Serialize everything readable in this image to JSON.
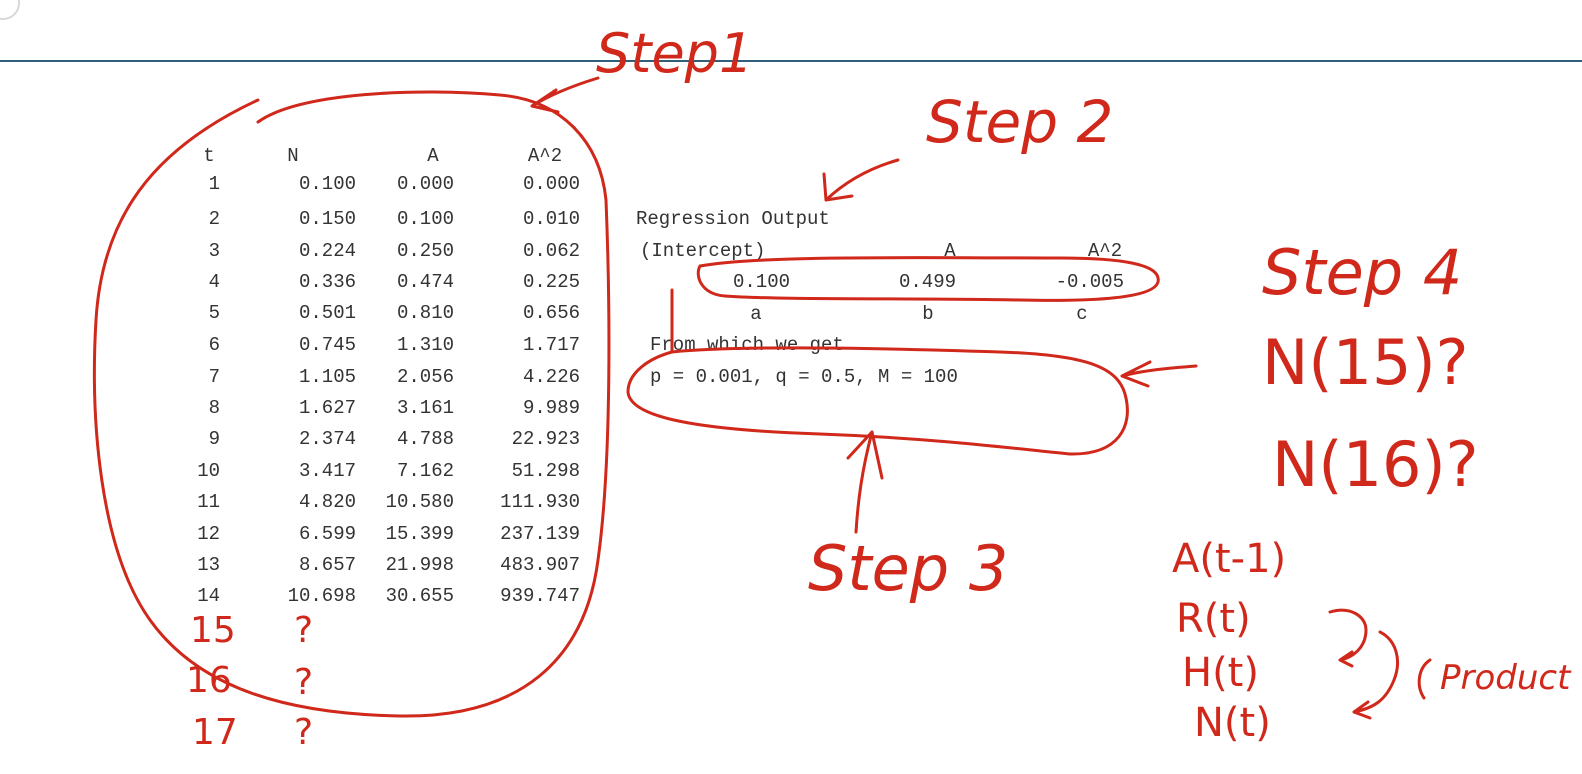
{
  "table": {
    "headers": [
      "t",
      "N",
      "A",
      "A^2"
    ],
    "rows": [
      [
        "1",
        "0.100",
        "0.000",
        "0.000"
      ],
      [
        "2",
        "0.150",
        "0.100",
        "0.010"
      ],
      [
        "3",
        "0.224",
        "0.250",
        "0.062"
      ],
      [
        "4",
        "0.336",
        "0.474",
        "0.225"
      ],
      [
        "5",
        "0.501",
        "0.810",
        "0.656"
      ],
      [
        "6",
        "0.745",
        "1.310",
        "1.717"
      ],
      [
        "7",
        "1.105",
        "2.056",
        "4.226"
      ],
      [
        "8",
        "1.627",
        "3.161",
        "9.989"
      ],
      [
        "9",
        "2.374",
        "4.788",
        "22.923"
      ],
      [
        "10",
        "3.417",
        "7.162",
        "51.298"
      ],
      [
        "11",
        "4.820",
        "10.580",
        "111.930"
      ],
      [
        "12",
        "6.599",
        "15.399",
        "237.139"
      ],
      [
        "13",
        "8.657",
        "21.998",
        "483.907"
      ],
      [
        "14",
        "10.698",
        "30.655",
        "939.747"
      ]
    ]
  },
  "regression": {
    "title": "Regression Output",
    "headers": [
      "(Intercept)",
      "A",
      "A^2"
    ],
    "values": [
      "0.100",
      "0.499",
      "-0.005"
    ],
    "letters": [
      "a",
      "b",
      "c"
    ],
    "from_text": "From which we get",
    "params": "p = 0.001, q = 0.5, M = 100"
  },
  "annotations": {
    "step1": "Step1",
    "step2": "Step 2",
    "step3": "Step 3",
    "step4": "Step 4",
    "n15": "N(15)?",
    "n16": "N(16)?",
    "missing_rows": [
      {
        "t": "15",
        "n": "?"
      },
      {
        "t": "16",
        "n": "?"
      },
      {
        "t": "17",
        "n": "?"
      }
    ],
    "formula": [
      "A(t-1)",
      "R(t)",
      "H(t)",
      "N(t)"
    ],
    "product": "Product"
  },
  "colors": {
    "ink": "#d0281a",
    "rule": "#2f5f7a",
    "text": "#333333"
  }
}
